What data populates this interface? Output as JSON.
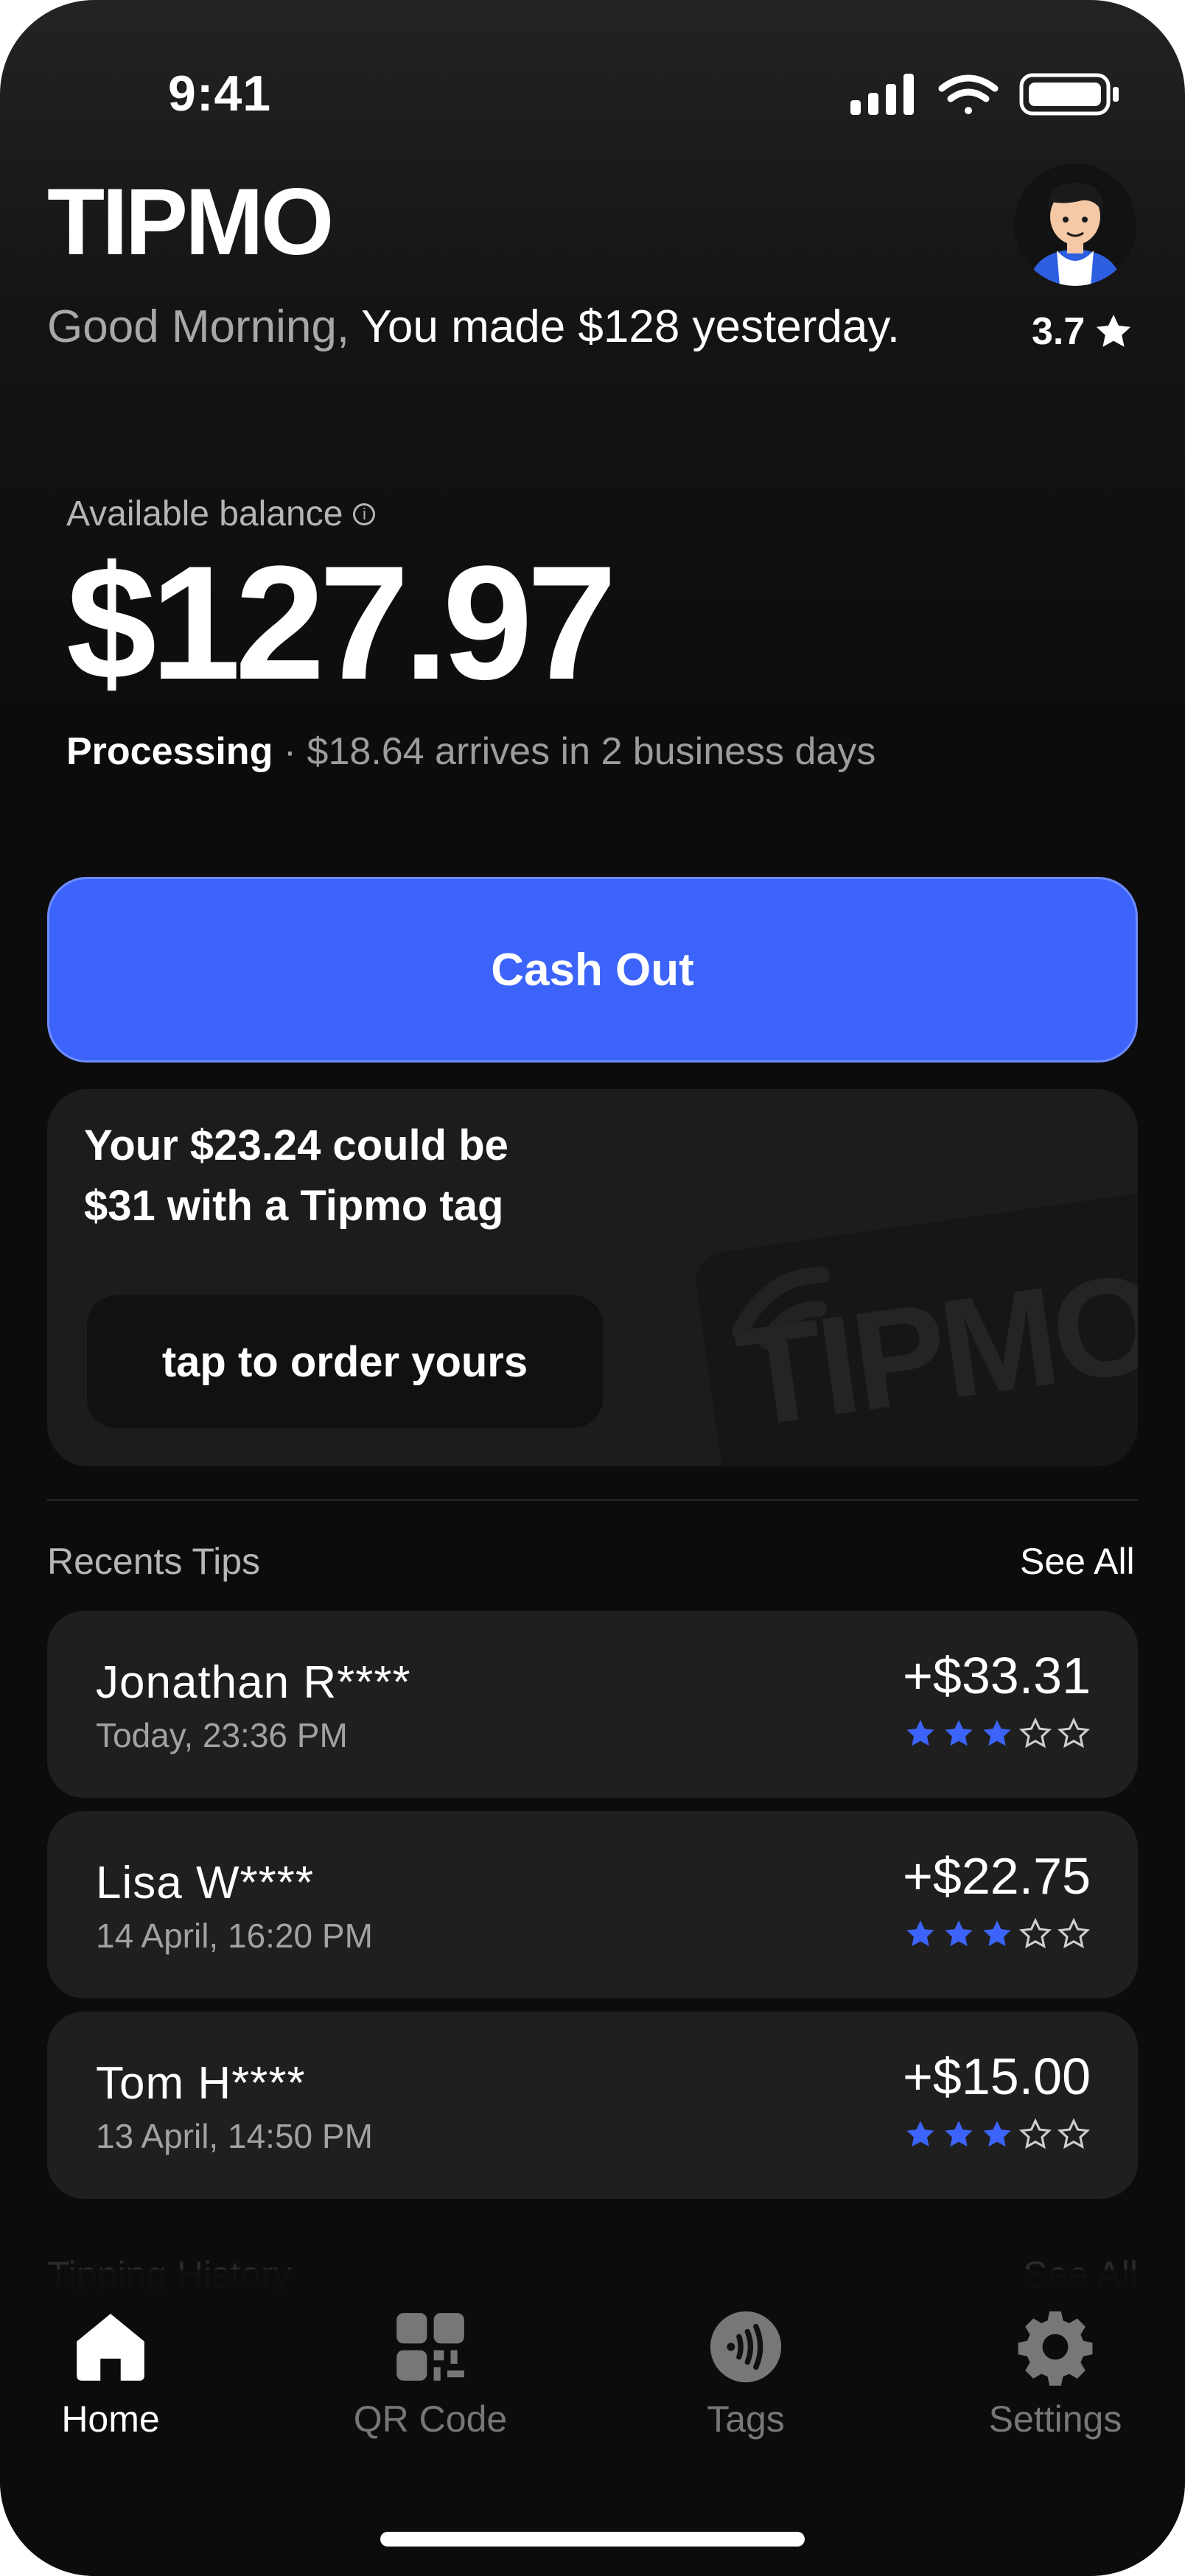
{
  "status_bar": {
    "time": "9:41"
  },
  "header": {
    "brand": "TIPMO",
    "greeting_muted": "Good Morning,",
    "greeting_main": " You made $128 yesterday.",
    "rating": "3.7"
  },
  "balance": {
    "label": "Available balance",
    "info_glyph": "i",
    "amount": "$127.97",
    "processing_label": "Processing",
    "processing_detail": " · $18.64 arrives in 2 business days"
  },
  "cashout": {
    "label": "Cash Out"
  },
  "promo": {
    "line1": "Your $23.24 could be",
    "line2": "$31 with a Tipmo tag",
    "button": "tap to order yours",
    "art_text": "TIPMO"
  },
  "recents": {
    "title": "Recents Tips",
    "see_all": "See All",
    "items": [
      {
        "name": "Jonathan R****",
        "date": "Today, 23:36 PM",
        "amount": "+$33.31",
        "stars": 3,
        "max_stars": 5
      },
      {
        "name": "Lisa W****",
        "date": "14 April, 16:20 PM",
        "amount": "+$22.75",
        "stars": 3,
        "max_stars": 5
      },
      {
        "name": "Tom H****",
        "date": "13 April, 14:50 PM",
        "amount": "+$15.00",
        "stars": 3,
        "max_stars": 5
      }
    ]
  },
  "history": {
    "title": "Tipping History",
    "see_all": "See All"
  },
  "tabs": [
    {
      "label": "Home",
      "icon": "home-icon",
      "active": true
    },
    {
      "label": "QR Code",
      "icon": "qr-code-icon",
      "active": false
    },
    {
      "label": "Tags",
      "icon": "nfc-tag-icon",
      "active": false
    },
    {
      "label": "Settings",
      "icon": "gear-icon",
      "active": false
    }
  ],
  "colors": {
    "accent": "#3c64fb",
    "background": "#0c0c0c",
    "card": "#1f1f1f",
    "muted_text": "#a2a2a2"
  }
}
